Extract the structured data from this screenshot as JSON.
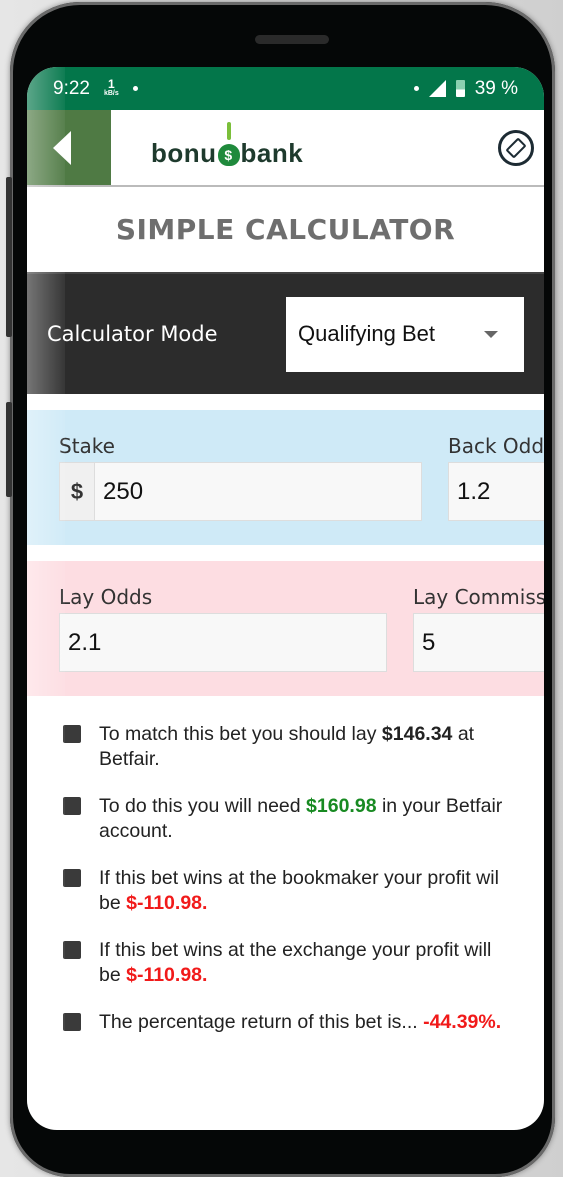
{
  "status_bar": {
    "time": "9:22",
    "net_speed_value": "1",
    "net_speed_unit": "kB/s",
    "battery": "39 %"
  },
  "app_bar": {
    "logo_left": "bonu",
    "logo_bag": "$",
    "logo_right": "bank",
    "back_icon": "back-triangle-icon",
    "reset_icon": "eraser-icon"
  },
  "page": {
    "title": "SIMPLE CALCULATOR"
  },
  "mode": {
    "label": "Calculator Mode",
    "selected": "Qualifying Bet"
  },
  "back_section": {
    "color": "#cfeaf7",
    "stake_label": "Stake",
    "stake_prefix": "$",
    "stake_value": "250",
    "back_odds_label": "Back Odds",
    "back_odds_value": "1.2"
  },
  "lay_section": {
    "color": "#fddde2",
    "lay_odds_label": "Lay Odds",
    "lay_odds_value": "2.1",
    "commission_label": "Lay Commission",
    "commission_value": "5",
    "commission_suffix": "%"
  },
  "results": [
    {
      "pre": "To match this bet you should lay ",
      "value": "$146.34",
      "post": " at Betfair.",
      "style": "bold"
    },
    {
      "pre": "To do this you will need  ",
      "value": "$160.98",
      "post": " in your Betfair account.",
      "style": "green"
    },
    {
      "pre": "If this bet wins at the bookmaker your profit wil be  ",
      "value": "$-110.98.",
      "post": "",
      "style": "red"
    },
    {
      "pre": "If this bet wins at the exchange your profit will be  ",
      "value": "$-110.98.",
      "post": "",
      "style": "red"
    },
    {
      "pre": "The percentage return of this bet is... ",
      "value": "-44.39%.",
      "post": "",
      "style": "red"
    }
  ],
  "colors": {
    "status_green": "#03764a",
    "back_button": "#4f7a44",
    "mode_bar": "#2c2c2c",
    "positive": "#188a22",
    "negative": "#f11a1a"
  }
}
